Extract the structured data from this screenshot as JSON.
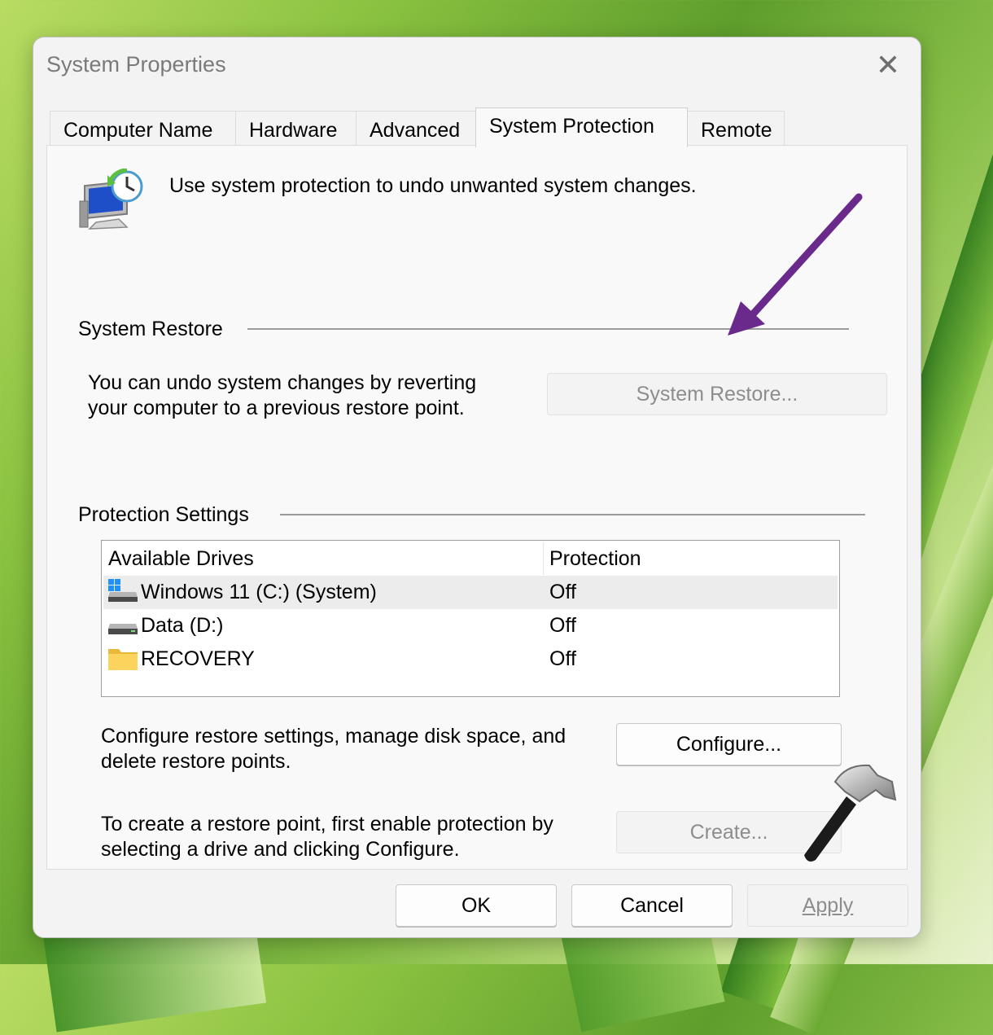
{
  "window": {
    "title": "System Properties"
  },
  "tabs": [
    {
      "label": "Computer Name",
      "active": false
    },
    {
      "label": "Hardware",
      "active": false
    },
    {
      "label": "Advanced",
      "active": false
    },
    {
      "label": "System Protection",
      "active": true
    },
    {
      "label": "Remote",
      "active": false
    }
  ],
  "panel": {
    "intro": "Use system protection to undo unwanted system changes.",
    "system_restore": {
      "group_label": "System Restore",
      "description_line1": "You can undo system changes by reverting",
      "description_line2": "your computer to a previous restore point.",
      "button_label": "System Restore..."
    },
    "protection_settings": {
      "group_label": "Protection Settings",
      "columns": [
        "Available Drives",
        "Protection"
      ],
      "drives": [
        {
          "name": "Windows 11 (C:) (System)",
          "protection": "Off",
          "icon": "windows-drive-icon"
        },
        {
          "name": "Data (D:)",
          "protection": "Off",
          "icon": "drive-icon"
        },
        {
          "name": "RECOVERY",
          "protection": "Off",
          "icon": "folder-icon"
        }
      ],
      "configure_text_line1": "Configure restore settings, manage disk space, and",
      "configure_text_line2": "delete restore points.",
      "configure_button": "Configure...",
      "create_text_line1": "To create a restore point, first enable protection by",
      "create_text_line2": "selecting a drive and clicking Configure.",
      "create_button": "Create..."
    }
  },
  "footer": {
    "ok": "OK",
    "cancel": "Cancel",
    "apply": "Apply"
  },
  "colors": {
    "annotation_arrow": "#6a2a8c",
    "disabled_text": "#8d8d8d"
  }
}
